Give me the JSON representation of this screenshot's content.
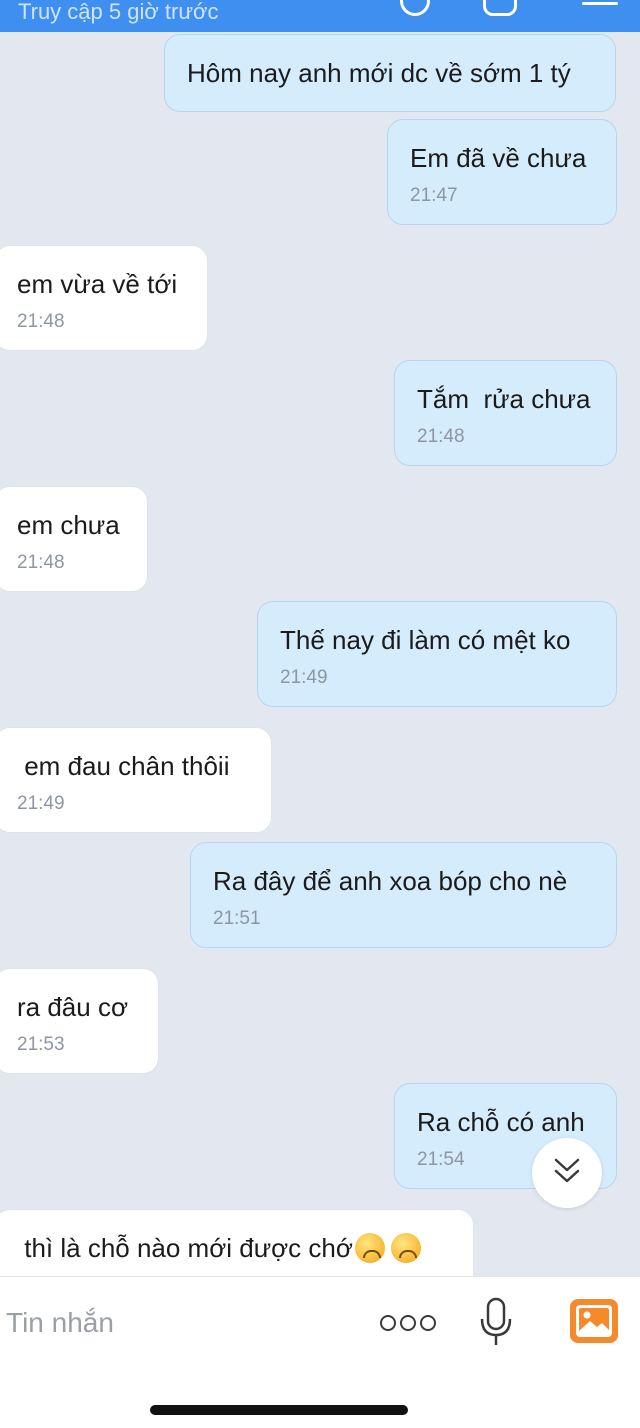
{
  "header": {
    "status": "Truy cập 5 giờ trước"
  },
  "messages": [
    {
      "side": "sent",
      "text": "Hôm nay anh mới dc về sớm 1 tý",
      "time": ""
    },
    {
      "side": "sent",
      "text": "Em đã về chưa",
      "time": "21:47"
    },
    {
      "side": "received",
      "text": "em vừa về tới",
      "time": "21:48"
    },
    {
      "side": "sent",
      "text": "Tắm  rửa chưa",
      "time": "21:48"
    },
    {
      "side": "received",
      "text": "em chưa",
      "time": "21:48"
    },
    {
      "side": "sent",
      "text": "Thế nay đi làm có mệt ko",
      "time": "21:49"
    },
    {
      "side": "received",
      "text": " em đau chân thôii",
      "time": "21:49"
    },
    {
      "side": "sent",
      "text": "Ra đây để anh xoa bóp cho nè",
      "time": "21:51"
    },
    {
      "side": "received",
      "text": "ra đâu cơ",
      "time": "21:53"
    },
    {
      "side": "sent",
      "text": "Ra chỗ có anh",
      "time": "21:54"
    },
    {
      "side": "received",
      "text": " thì là chỗ nào mới được chớ",
      "time": "",
      "emojis": [
        "upside-down-face-icon",
        "upside-down-face-icon"
      ]
    }
  ],
  "input": {
    "placeholder": "Tin nhắn"
  },
  "icons": {
    "more": "more-dots-icon",
    "mic": "microphone-icon",
    "image": "image-gallery-icon",
    "scroll": "double-chevron-down-icon"
  },
  "colors": {
    "header": "#3f8ff0",
    "sent_bubble": "#d5ecfd",
    "received_bubble": "#ffffff",
    "background": "#e3e7ef",
    "image_icon": "#f58a2d"
  }
}
